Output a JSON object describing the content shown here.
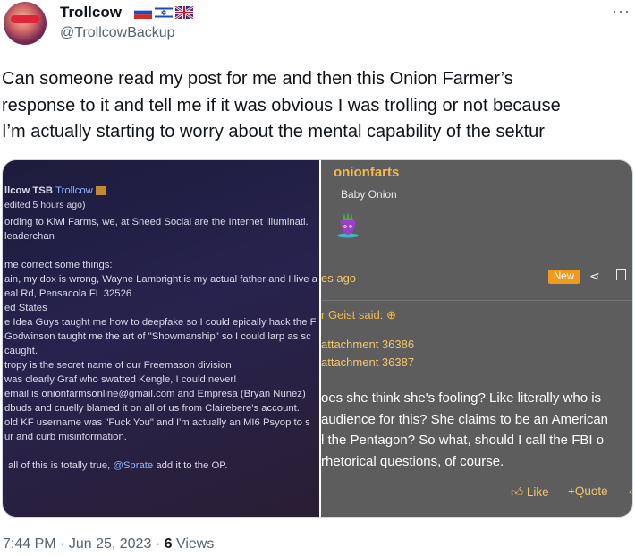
{
  "author": {
    "display_name": "Trollcow",
    "handle": "@TrollcowBackup",
    "flags": [
      "russia-flag",
      "israel-flag",
      "uk-flag"
    ]
  },
  "more_icon": "more-dots-icon",
  "tweet": {
    "text_lines": [
      "Can someone read my post for me and then this Onion Farmer’s",
      "response to it and tell me if it was obvious I was trolling or not because",
      "I’m actually starting to worry about the mental capability of the sektur"
    ]
  },
  "left_image": {
    "header_name": "llcow TSB",
    "header_user": "Trollcow",
    "edited": "edited 5 hours ago)",
    "lines": [
      "ording to Kiwi Farms, we, at Sneed Social are the Internet Illuminati.",
      "leaderchan",
      "me correct some things:",
      "ain, my dox is wrong, Wayne Lambright is my actual father and I live a",
      "eal Rd, Pensacola FL 32526",
      "ed States",
      "e Idea Guys taught me how to deepfake so I could epically hack the F",
      "Godwinson taught me the art of \"Showmanship\" so I could larp as sc",
      "caught.",
      "tropy is the secret name of our Freemason division",
      "was clearly Graf who swatted Kengle, I could never!",
      "email is onionfarmsonline@gmail.com and Empresa (Bryan Nunez)",
      "dbuds and cruelly blamed it on all of us from Clairebere's account.",
      "old KF username was \"Fuck You\" and I'm actually an MI6 Psyop to s",
      "ur and curb misinformation."
    ],
    "closing_text": "all of this is totally true,",
    "closing_mention": "@Sprate",
    "closing_end": "add it to the OP."
  },
  "right_image": {
    "username": "onionfarts",
    "user_title": "Baby Onion",
    "time_ago": "es ago",
    "new_badge": "New",
    "quote_header": "r Geist said:",
    "attachments": [
      "attachment 36386",
      "attachment 36387"
    ],
    "body_lines": [
      "oes she think she's fooling? Like literally who is",
      "audience for this? She claims to be an American",
      "l the Pentagon? So what, should I call the FBI o",
      "rhetorical questions, of course."
    ],
    "like_label": "Like",
    "quote_label": "+Quote",
    "chevron": "‹"
  },
  "meta": {
    "time": "7:44 PM",
    "date": "Jun 25, 2023",
    "views_count": "6",
    "views_label": "Views"
  }
}
